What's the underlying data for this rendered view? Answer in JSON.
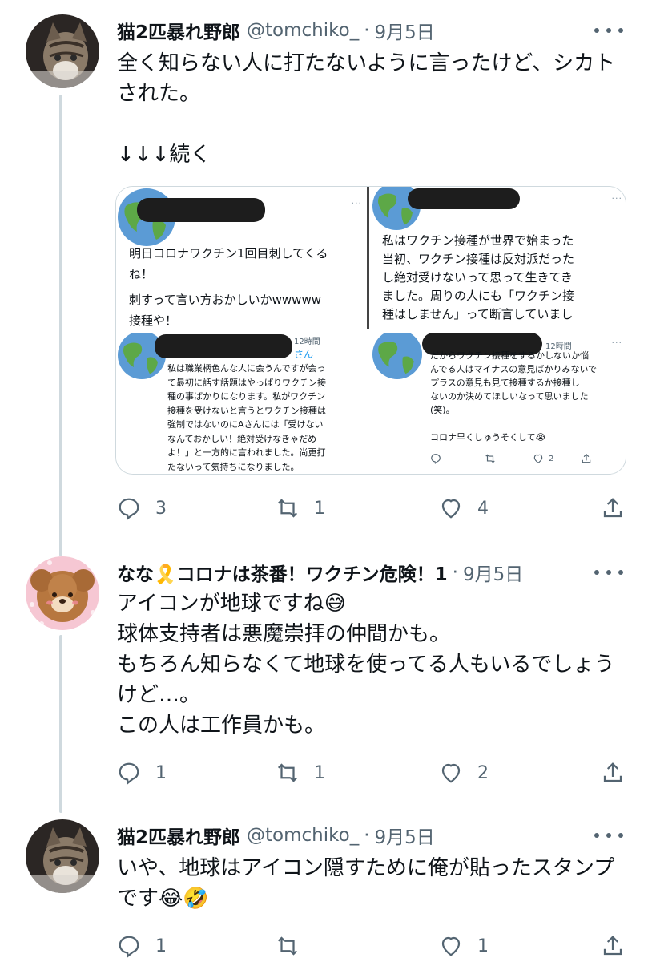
{
  "tweets": [
    {
      "name": "猫2匹暴れ野郎",
      "handle": "@tomchiko_",
      "sep": "·",
      "time": "9月5日",
      "lines": [
        "全く知らない人に打たないように言ったけど、シカト",
        "された。",
        "",
        "↓↓↓続く"
      ],
      "replies": "3",
      "retweets": "1",
      "likes": "4"
    },
    {
      "name": "なな🎗️コロナは茶番！ワクチン危険！1",
      "handle": "",
      "sep": "·",
      "time": "9月5日",
      "lines": [
        "アイコンが地球ですね😅",
        "球体支持者は悪魔崇拝の仲間かも。",
        "もちろん知らなくて地球を使ってる人もいるでしょう",
        "けど…。",
        "この人は工作員かも。"
      ],
      "replies": "1",
      "retweets": "1",
      "likes": "2"
    },
    {
      "name": "猫2匹暴れ野郎",
      "handle": "@tomchiko_",
      "sep": "·",
      "time": "9月5日",
      "lines": [
        "いや、地球はアイコン隠すために俺が貼ったスタンプ",
        "です😂🤣"
      ],
      "replies": "1",
      "retweets": "",
      "likes": "1"
    }
  ],
  "media": {
    "panels": [
      {
        "dots": "···",
        "lines": [
          "明日コロナワクチン1回目刺してくる",
          "ね！",
          "刺すって言い方おかしいかwwwww",
          "接種や！"
        ]
      },
      {
        "dots": "···",
        "lines": [
          "私はワクチン接種が世界で始まった",
          "当初、ワクチン接種は反対派だった",
          "し絶対受けないって思って生きてき",
          "ました。周りの人にも「ワクチン接",
          "種はしません」って断言していまし"
        ]
      },
      {
        "meta": "12時間",
        "sname": "さん",
        "lines": [
          "私は職業柄色んな人に会うんですが会っ",
          "て最初に話す話題はやっぱりワクチン接",
          "種の事ばかりになります。私がワクチン",
          "接種を受けないと言うとワクチン接種は",
          "強制ではないのにAさんには「受けない",
          "なんておかしい！絶対受けなきゃだめ",
          "よ！」と一方的に言われました。尚更打",
          "たないって気持ちになりました。"
        ]
      },
      {
        "meta": "12時間",
        "dots": "···",
        "lines": [
          "だからワクチン接種をするかしないか悩",
          "んでる人はマイナスの意見ばかりみないで",
          "プラスの意見も見て接種するか接種し",
          "ないのか決めてほしいなって思いました",
          "(笑)。",
          "",
          "コロナ早くしゅうそくして😭"
        ],
        "likes": "2"
      }
    ]
  },
  "colors": {
    "text": "#0f1419",
    "muted": "#536471",
    "line": "#cfd9de",
    "link": "#1d9bf0"
  }
}
